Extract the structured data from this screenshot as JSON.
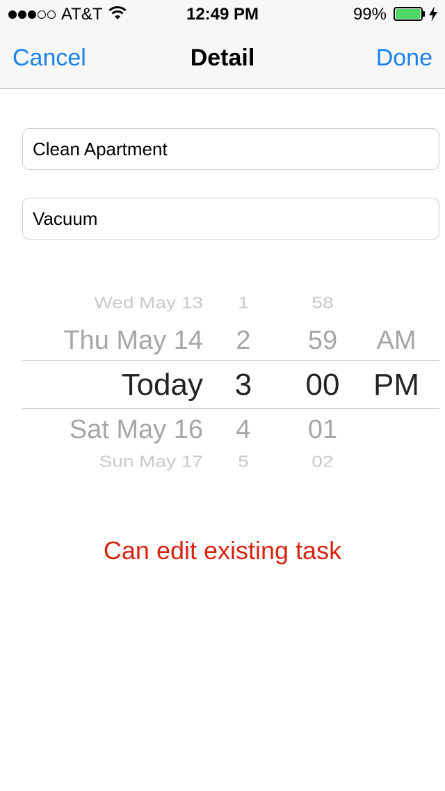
{
  "status_bar": {
    "carrier": "AT&T",
    "time": "12:49 PM",
    "battery_percent": "99%",
    "signal_bars_filled": 3,
    "signal_bars_total": 5,
    "battery_level": 0.99,
    "battery_color": "#4cd964"
  },
  "nav": {
    "cancel_label": "Cancel",
    "title": "Detail",
    "done_label": "Done",
    "accent_color": "#1a82e8"
  },
  "form": {
    "task_name": "Clean Apartment",
    "task_notes": "Vacuum"
  },
  "date_picker": {
    "dates": [
      "Wed May 13",
      "Thu May 14",
      "Today",
      "Sat May 16",
      "Sun May 17"
    ],
    "hours": [
      "1",
      "2",
      "3",
      "4",
      "5"
    ],
    "minutes": [
      "58",
      "59",
      "00",
      "01",
      "02"
    ],
    "meridiem": [
      "",
      "AM",
      "PM",
      "",
      ""
    ],
    "selected": {
      "date": "Today",
      "hour": "3",
      "minute": "00",
      "meridiem": "PM"
    }
  },
  "caption": {
    "text": "Can edit existing task",
    "color": "#d8230f"
  }
}
